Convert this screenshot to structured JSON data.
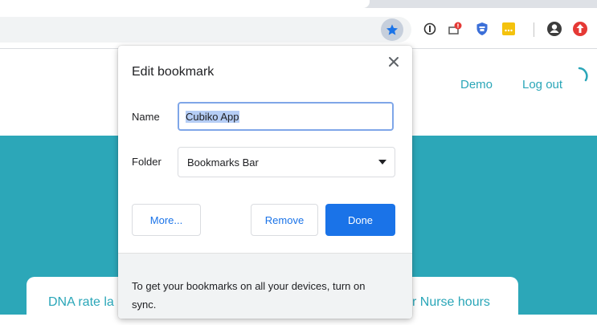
{
  "browser": {
    "bookmark_star_icon": "star-icon",
    "extensions": [
      "extension-1-icon",
      "extension-alert-icon",
      "extension-shield-icon",
      "extension-yellow-icon"
    ],
    "profile_icon": "profile-icon",
    "update_icon": "update-icon",
    "colors": {
      "star_active": "#1a73e8",
      "update": "#e53935"
    }
  },
  "site": {
    "nav": {
      "demo": "Demo",
      "logout": "Log out"
    },
    "cards": {
      "left_label": "DNA rate la",
      "right_label": "r Nurse hours"
    },
    "colors": {
      "hero": "#2ca7b8",
      "link": "#2aa6b8"
    }
  },
  "popup": {
    "title": "Edit bookmark",
    "name_label": "Name",
    "name_value": "Cubiko App",
    "folder_label": "Folder",
    "folder_value": "Bookmarks Bar",
    "more_button": "More...",
    "remove_button": "Remove",
    "done_button": "Done",
    "footer_text": "To get your bookmarks on all your devices, turn on sync.",
    "colors": {
      "primary": "#1a73e8",
      "focus_border": "#7fa6e8",
      "selection": "#b5cdf5"
    }
  }
}
